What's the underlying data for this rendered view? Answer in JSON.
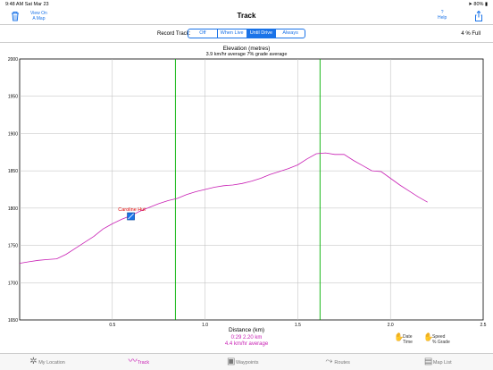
{
  "status": {
    "time": "9:48 AM",
    "date": "Sat Mar 23",
    "battery": "80%"
  },
  "nav": {
    "title": "Track",
    "view_on_map": "View On\nA Map",
    "help": "?\nHelp"
  },
  "record": {
    "label": "Record Track:",
    "options": [
      "Off",
      "When Live",
      "Until Drive",
      "Always"
    ],
    "selected": "Until Drive",
    "full": "4 % Full"
  },
  "chart_data": {
    "type": "line",
    "title": "Elevation (metres)",
    "subtitle": "3.9 km/hr average  7% grade average",
    "xlabel": "Distance (km)",
    "xlim": [
      0,
      2.5
    ],
    "ylim": [
      1650,
      2000
    ],
    "x_ticks": [
      "0.5",
      "1.0",
      "1.5",
      "2.0",
      "2.5"
    ],
    "y_ticks": [
      "1650",
      "1700",
      "1750",
      "1800",
      "1850",
      "1900",
      "1950",
      "2000"
    ],
    "grid": true,
    "markers": [
      0.84,
      1.62
    ],
    "waypoint": {
      "name": "Caroline Hut",
      "x": 0.6,
      "y": 1789
    },
    "series": [
      {
        "color": "#c81eb4",
        "x": [
          0,
          0.05,
          0.1,
          0.15,
          0.2,
          0.25,
          0.3,
          0.35,
          0.4,
          0.45,
          0.5,
          0.55,
          0.6,
          0.65,
          0.7,
          0.75,
          0.8,
          0.85,
          0.9,
          0.95,
          1.0,
          1.05,
          1.1,
          1.15,
          1.2,
          1.25,
          1.3,
          1.35,
          1.4,
          1.45,
          1.5,
          1.55,
          1.6,
          1.65,
          1.7,
          1.75,
          1.8,
          1.85,
          1.9,
          1.95,
          2.0,
          2.05,
          2.1,
          2.15,
          2.2
        ],
        "y": [
          1726,
          1728,
          1730,
          1731,
          1732,
          1738,
          1746,
          1754,
          1762,
          1772,
          1779,
          1785,
          1790,
          1796,
          1801,
          1806,
          1810,
          1813,
          1818,
          1822,
          1825,
          1828,
          1830,
          1831,
          1833,
          1836,
          1840,
          1845,
          1849,
          1853,
          1858,
          1866,
          1873,
          1874,
          1872,
          1872,
          1864,
          1857,
          1850,
          1849,
          1840,
          1831,
          1823,
          1815,
          1808
        ]
      }
    ]
  },
  "summary": {
    "line1": "0:29    2.20 km",
    "line2": "4.4 km/hr average"
  },
  "options": {
    "date_time": "Date\nTime",
    "speed_grade": "Speed\n% Grade"
  },
  "tabs": [
    {
      "label": "My Location",
      "icon": "gear-icon"
    },
    {
      "label": "Track",
      "icon": "track-icon"
    },
    {
      "label": "Waypoints",
      "icon": "waypoint-icon"
    },
    {
      "label": "Routes",
      "icon": "routes-icon"
    },
    {
      "label": "Map List",
      "icon": "map-list-icon"
    }
  ],
  "colors": {
    "accent": "#1a73e8",
    "track": "#c81eb4",
    "marker": "#00b000"
  }
}
